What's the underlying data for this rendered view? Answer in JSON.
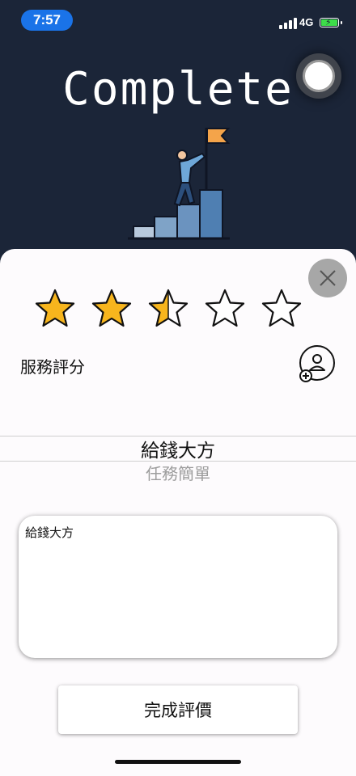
{
  "status_bar": {
    "time": "7:57",
    "network": "4G",
    "battery_level": 1.0
  },
  "header": {
    "title": "Complete"
  },
  "rating": {
    "stars_total": 5,
    "stars_value": 2.5,
    "label": "服務評分",
    "filled_color": "#f7b51d"
  },
  "picker": {
    "selected": "給錢大方",
    "next": "任務簡單"
  },
  "comment": {
    "value": "給錢大方"
  },
  "submit": {
    "label": "完成評價"
  },
  "icons": {
    "close": "close-icon",
    "add_user": "add-user-icon",
    "assistive_touch": "assistive-touch-icon"
  }
}
